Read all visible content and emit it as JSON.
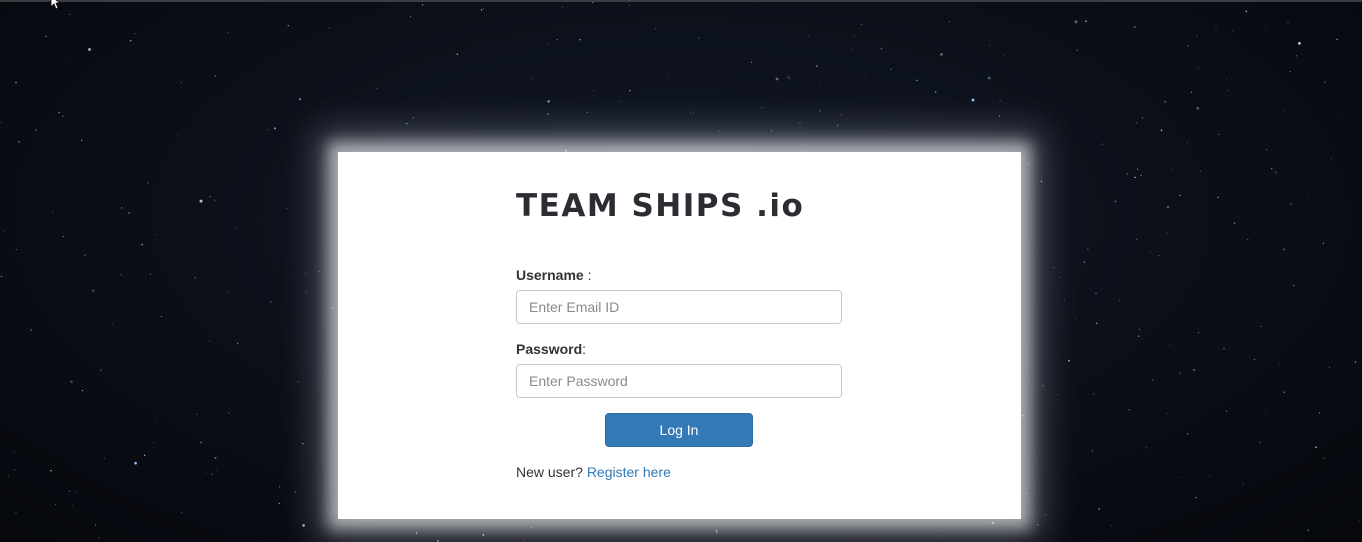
{
  "brand": {
    "title": "TEAM SHIPS .io"
  },
  "login_form": {
    "username": {
      "label": "Username",
      "colon": " :",
      "placeholder": "Enter Email ID",
      "value": ""
    },
    "password": {
      "label": "Password",
      "colon": ":",
      "placeholder": "Enter Password",
      "value": ""
    },
    "submit_label": "Log In",
    "register_prompt": "New user?",
    "register_link": "Register here"
  },
  "colors": {
    "background": "#0b0f18",
    "panel": "#ffffff",
    "primary_button": "#337ab7",
    "link": "#337ab7",
    "label_text": "#333333"
  },
  "icons": {
    "cursor": "mouse-pointer-icon"
  }
}
